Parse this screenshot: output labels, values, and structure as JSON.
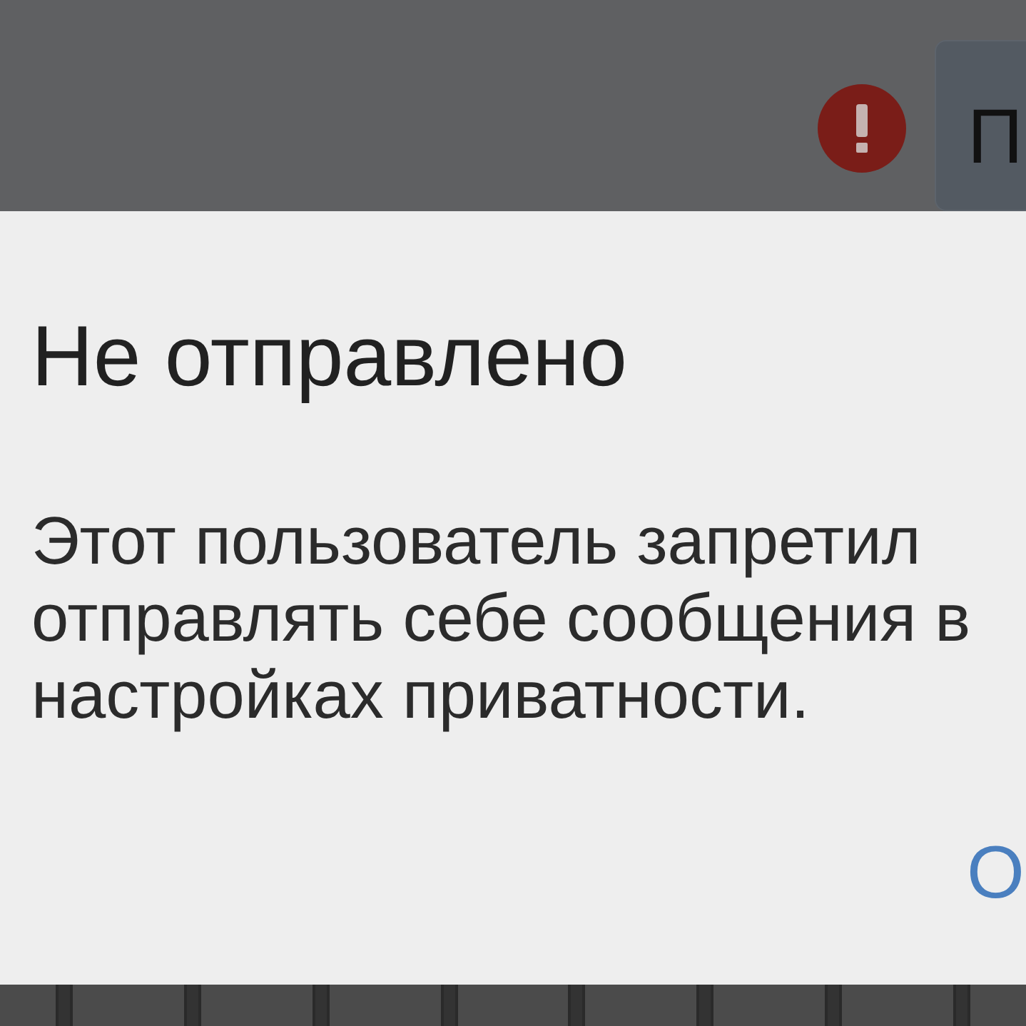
{
  "background": {
    "message_bubble": {
      "text": "П"
    }
  },
  "dialog": {
    "title": "Не отправлено",
    "message": "Этот пользователь запретил отправлять себе сообщения в настройках приватности.",
    "buttons": [
      {
        "label": "О"
      }
    ]
  }
}
